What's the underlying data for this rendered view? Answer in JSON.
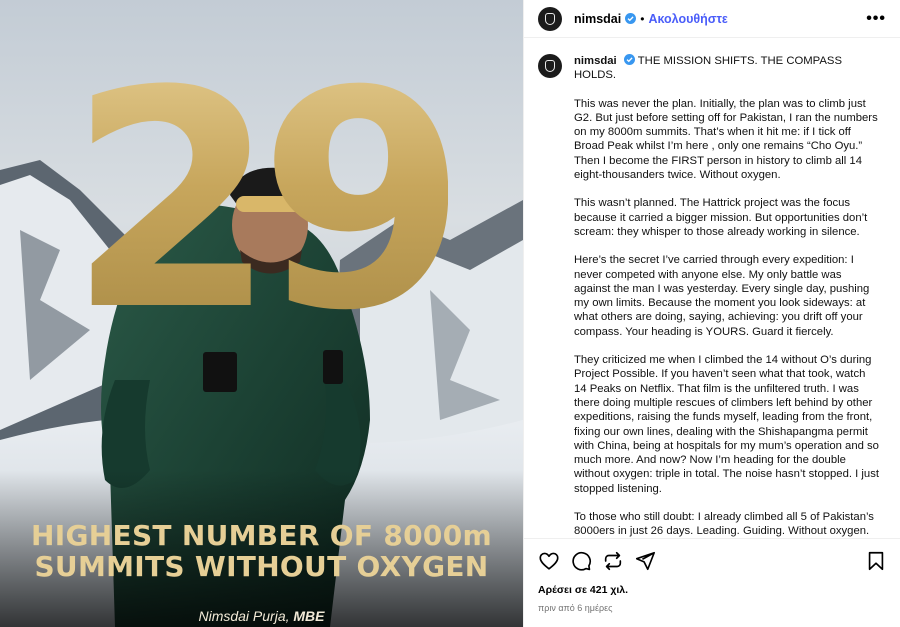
{
  "media": {
    "big_number": "29",
    "headline_line1": "HIGHEST NUMBER OF 8000m",
    "headline_line2": "SUMMITS WITHOUT OXYGEN",
    "credit_name": "Nimsdai Purja, ",
    "credit_suffix": "MBE"
  },
  "header": {
    "username": "nimsdai",
    "separator": "•",
    "follow_label": "Ακολουθήστε",
    "more_label": "•••"
  },
  "caption": {
    "username": "nimsdai",
    "title": "THE MISSION SHIFTS. THE COMPASS HOLDS.",
    "paragraphs": [
      "This was never the plan. Initially, the plan was to climb just G2. But just before setting off for Pakistan, I ran the numbers on my 8000m summits. That’s when it hit me: if I tick off Broad Peak whilst I’m here , only one remains “Cho Oyu.” Then I become the FIRST person in history to climb all 14 eight-thousanders twice. Without oxygen.",
      "This wasn’t planned. The Hattrick project was the focus because it carried a bigger mission. But opportunities don’t scream: they whisper to those already working in silence.",
      "Here’s the secret I’ve carried through every expedition: I never competed with anyone else. My only battle was against the man I was yesterday. Every single day, pushing my own limits. Because the moment you look sideways: at what others are doing, saying, achieving: you drift off your compass. Your heading is YOURS. Guard it fiercely.",
      "They criticized me when I climbed the 14 without O’s during Project Possible. If you haven’t seen what that took, watch 14 Peaks on Netflix. That film is the unfiltered truth. I was there doing multiple rescues of climbers left behind by other expeditions, raising the funds myself, leading from the front, fixing our own lines, dealing with the Shishapangma permit with China, being at hospitals for my mum’s operation and so much more. And now? Now I’m heading for the double without oxygen: triple in total. The noise hasn’t stopped. I just stopped listening.",
      "To those who still doubt: I already climbed all 5 of Pakistan’s 8000ers in just 26 days. Leading. Guiding. Without oxygen. Breaking the records of those who broke mine with oxygen. The receipts are there."
    ]
  },
  "footer": {
    "likes": "Αρέσει σε 421 χιλ.",
    "time": "πριν από 6 ημέρες"
  },
  "icons": [
    "heart-icon",
    "comment-icon",
    "repost-icon",
    "share-icon",
    "bookmark-icon",
    "verified-badge-icon"
  ],
  "colors": {
    "accent_blue": "#4a5df9",
    "gold": "#c9ab62",
    "jacket_green": "#1f4a3a",
    "verified": "#3897f0"
  }
}
